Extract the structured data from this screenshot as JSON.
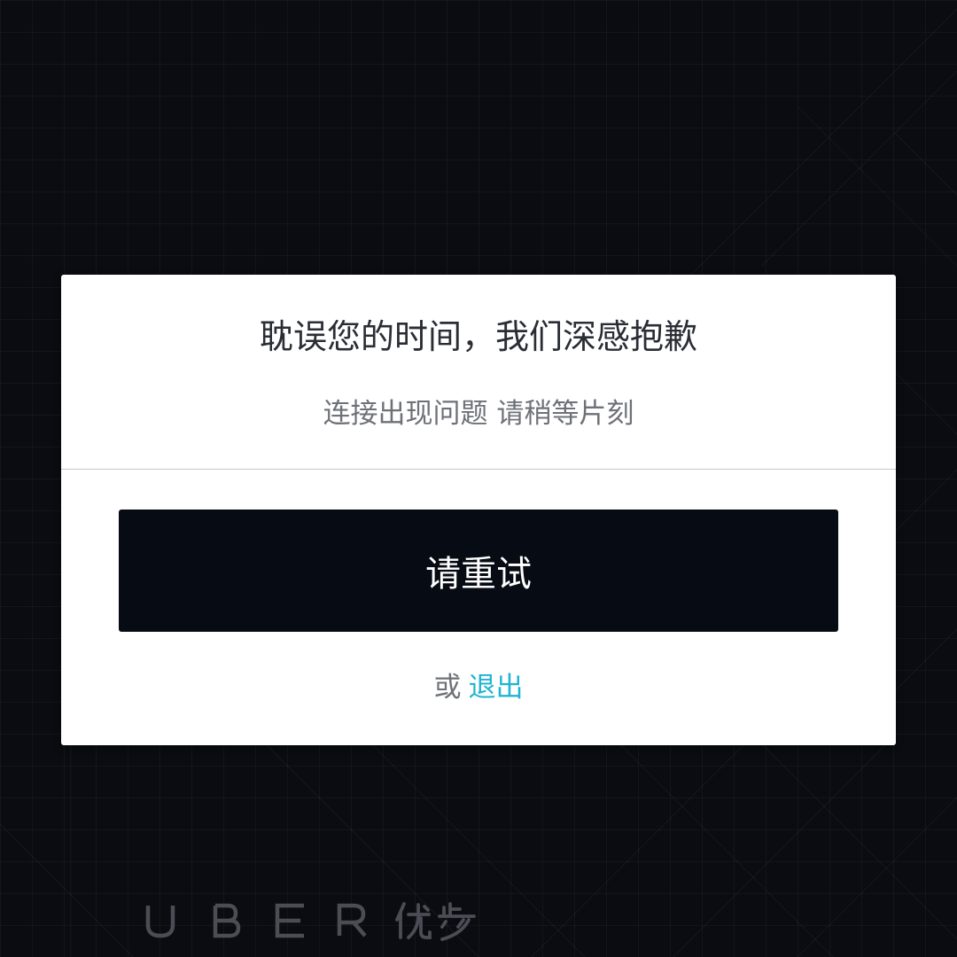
{
  "dialog": {
    "title": "耽误您的时间，我们深感抱歉",
    "message": "连接出现问题 请稍等片刻",
    "retry_label": "请重试",
    "or_text": "或",
    "exit_label": "退出"
  },
  "brand": {
    "logo_text": "UBER 优步"
  },
  "colors": {
    "link": "#1fb4d2",
    "button_bg": "#070b14",
    "background": "#0a0c11"
  }
}
